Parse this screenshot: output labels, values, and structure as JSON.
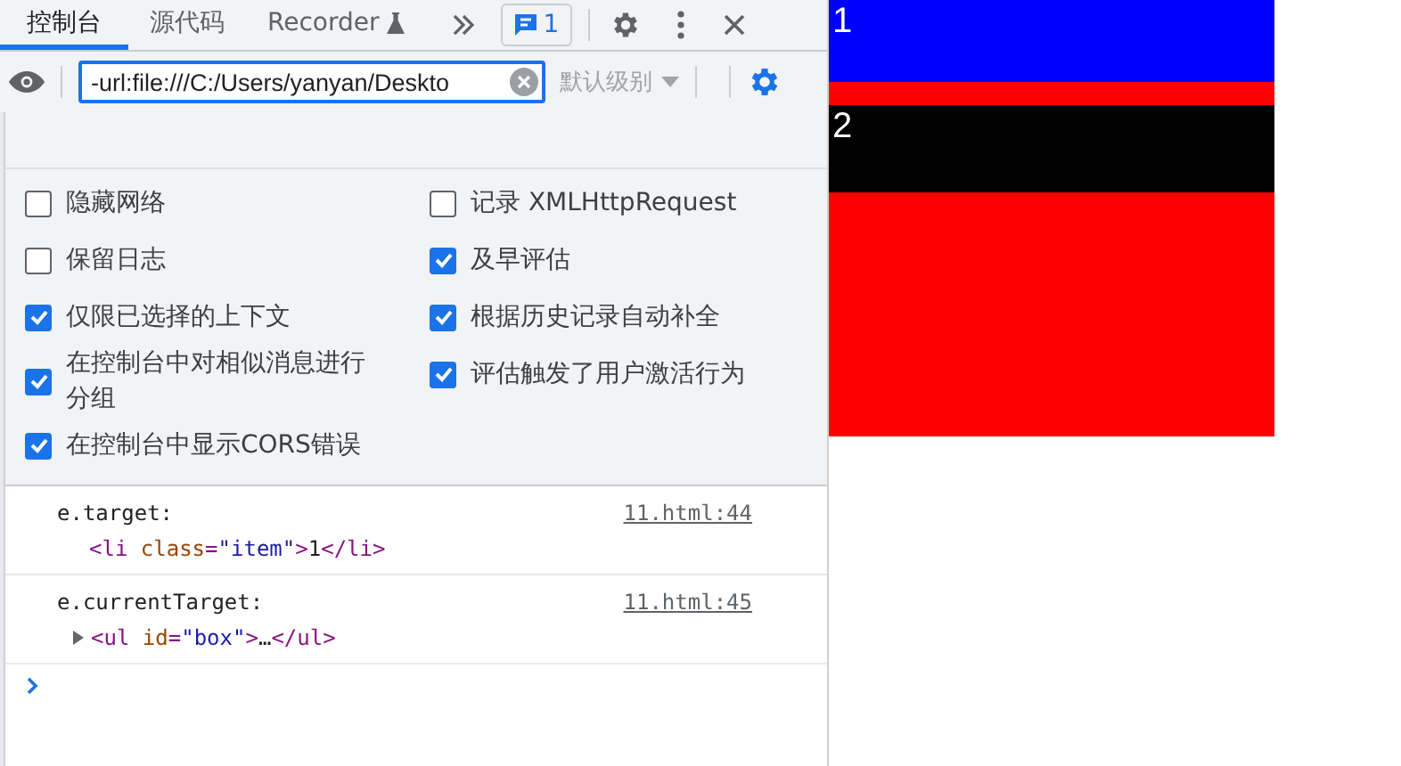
{
  "tabs": [
    {
      "label": "控制台",
      "selected": true,
      "kind": "plain"
    },
    {
      "label": "源代码",
      "selected": false,
      "kind": "plain"
    },
    {
      "label": "Recorder",
      "selected": false,
      "kind": "experimental"
    }
  ],
  "issues_badge": "1",
  "filter": {
    "value": "-url:file:///C:/Users/yanyan/Deskto"
  },
  "level_dropdown": {
    "label": "默认级别",
    "disabled": true
  },
  "settings": {
    "left": [
      {
        "label": "隐藏网络",
        "checked": false
      },
      {
        "label": "保留日志",
        "checked": false
      },
      {
        "label": "仅限已选择的上下文",
        "checked": true
      },
      {
        "label": "在控制台中对相似消息进行分组",
        "checked": true
      },
      {
        "label": "在控制台中显示CORS错误",
        "checked": true
      }
    ],
    "right": [
      {
        "label": "记录 XMLHttpRequest",
        "checked": false
      },
      {
        "label": "及早评估",
        "checked": true
      },
      {
        "label": "根据历史记录自动补全",
        "checked": true
      },
      {
        "label": "评估触发了用户激活行为",
        "checked": true
      }
    ]
  },
  "messages": [
    {
      "label": "e.target:",
      "source": "11.html:44",
      "expandable": false,
      "tokens": [
        {
          "kind": "tag",
          "text": "<li"
        },
        {
          "kind": "attr",
          "text": " class"
        },
        {
          "kind": "tag",
          "text": "="
        },
        {
          "kind": "value",
          "text": "\"item\""
        },
        {
          "kind": "tag",
          "text": ">"
        },
        {
          "kind": "text",
          "text": "1"
        },
        {
          "kind": "tag",
          "text": "</li>"
        }
      ]
    },
    {
      "label": "e.currentTarget:",
      "source": "11.html:45",
      "expandable": true,
      "tokens": [
        {
          "kind": "tag",
          "text": "<ul"
        },
        {
          "kind": "attr",
          "text": " id"
        },
        {
          "kind": "tag",
          "text": "="
        },
        {
          "kind": "value",
          "text": "\"box\""
        },
        {
          "kind": "tag",
          "text": ">"
        },
        {
          "kind": "text",
          "text": "…"
        },
        {
          "kind": "tag",
          "text": "</ul>"
        }
      ]
    }
  ],
  "page": {
    "items": [
      {
        "label": "1",
        "color": "#0000ff"
      },
      {
        "label": "2",
        "color": "#000000"
      }
    ]
  }
}
